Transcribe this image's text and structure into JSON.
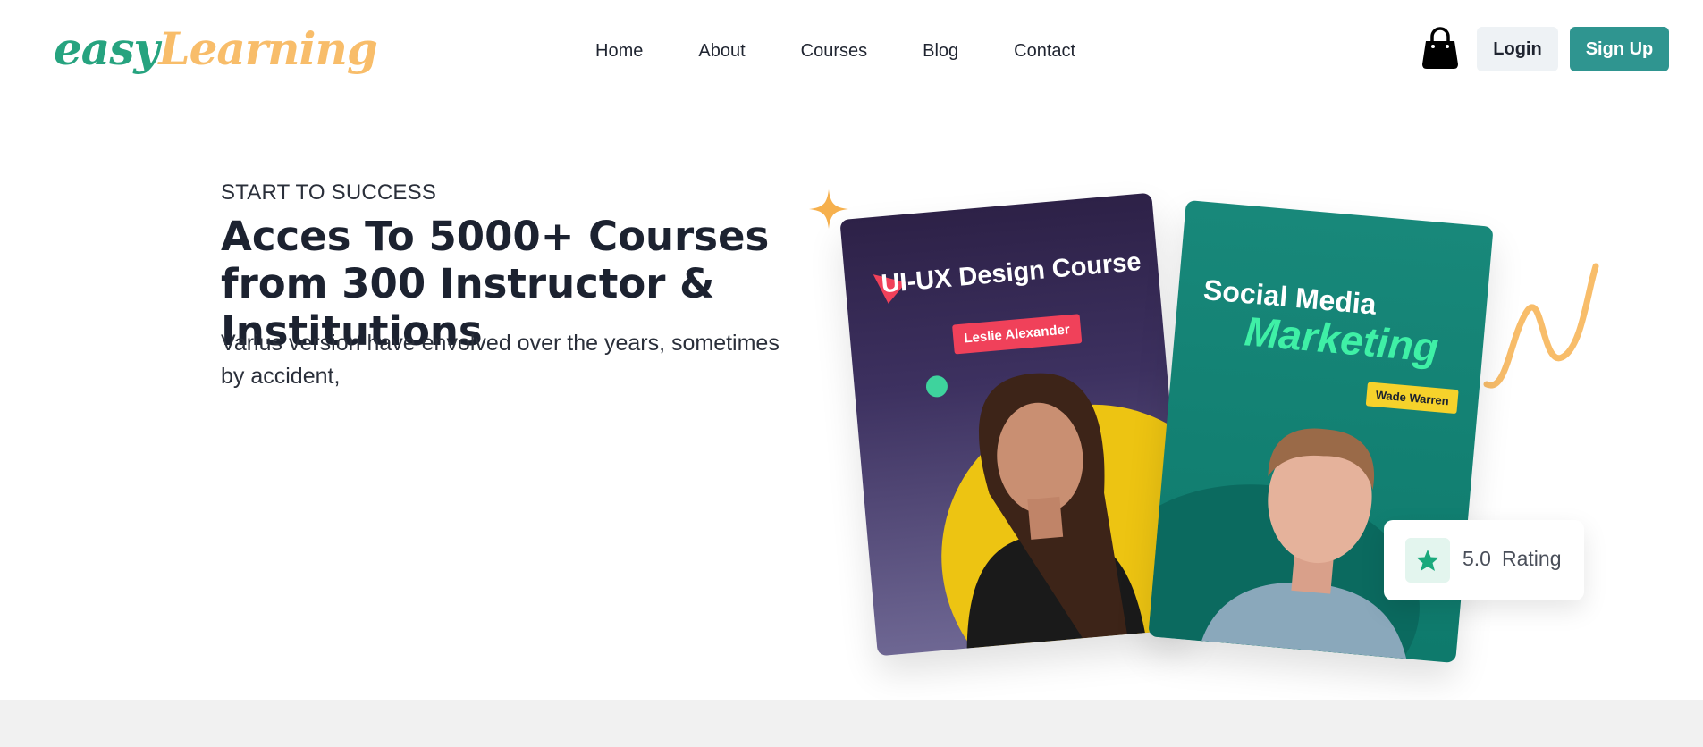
{
  "logo": {
    "part1": "easy",
    "part2": "Learning"
  },
  "nav": {
    "home": "Home",
    "about": "About",
    "courses": "Courses",
    "blog": "Blog",
    "contact": "Contact"
  },
  "header": {
    "cart_icon": "shopping-bag-icon",
    "login_label": "Login",
    "signup_label": "Sign Up"
  },
  "hero": {
    "eyebrow": "START TO SUCCESS",
    "headline": "Acces To 5000+ Courses from 300 Instructor & Institutions",
    "description": "Varius version have envolved over the years, sometimes by accident,"
  },
  "cards": {
    "card1": {
      "title": "UI-UX Design Course",
      "instructor": "Leslie Alexander"
    },
    "card2": {
      "title_line1": "Social Media",
      "title_line2": "Marketing",
      "instructor": "Wade Warren"
    }
  },
  "rating": {
    "score": "5.0",
    "label": "Rating",
    "icon": "star-icon"
  },
  "colors": {
    "accent": "#2f9590",
    "logo_green": "#26a37f",
    "logo_orange": "#f8bd6a"
  }
}
